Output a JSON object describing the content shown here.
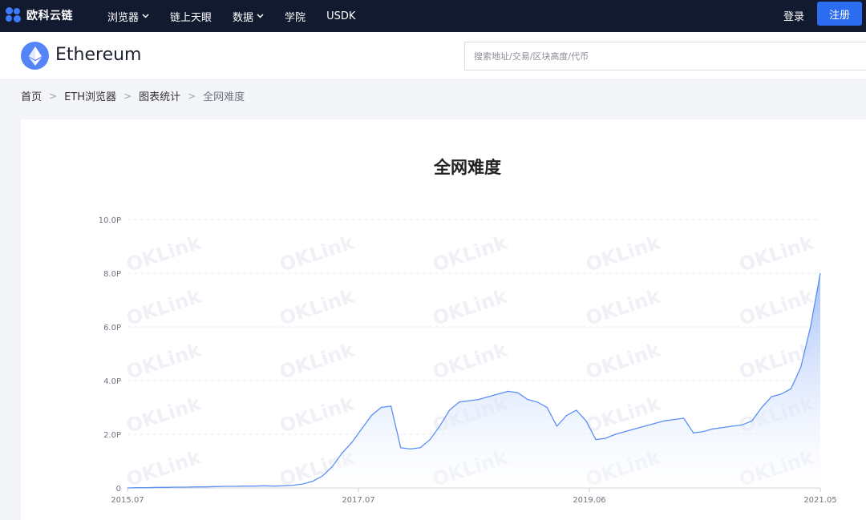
{
  "brand": {
    "name": "欧科云链",
    "logo_icon": "okcloud-logo-icon",
    "accent": "#3f7bff"
  },
  "nav": {
    "items": [
      {
        "label": "浏览器",
        "has_dropdown": true
      },
      {
        "label": "链上天眼",
        "has_dropdown": false
      },
      {
        "label": "数据",
        "has_dropdown": true
      },
      {
        "label": "学院",
        "has_dropdown": false
      },
      {
        "label": "USDK",
        "has_dropdown": false
      }
    ],
    "login_label": "登录",
    "register_label": "注册",
    "register_color": "#2b6cf1"
  },
  "header": {
    "chain_name": "Ethereum",
    "chain_icon": "ethereum-icon",
    "search_placeholder": "搜索地址/交易/区块高度/代币"
  },
  "breadcrumb": [
    "首页",
    "ETH浏览器",
    "图表统计",
    "全网难度"
  ],
  "breadcrumb_separator": ">",
  "watermark": "OKLink",
  "chart_data": {
    "type": "area",
    "title": "全网难度",
    "xlabel": "",
    "ylabel": "",
    "y_ticks": [
      "0",
      "2.0P",
      "4.0P",
      "6.0P",
      "8.0P",
      "10.0P"
    ],
    "ylim": [
      0,
      10
    ],
    "x_ticks": [
      "2015.07",
      "2017.07",
      "2019.06",
      "2021.05"
    ],
    "grid": true,
    "line_color": "#5b8ff5",
    "x": [
      0,
      1,
      2,
      3,
      4,
      5,
      6,
      7,
      8,
      9,
      10,
      11,
      12,
      13,
      14,
      15,
      16,
      17,
      18,
      19,
      20,
      21,
      22,
      23,
      24,
      25,
      26,
      27,
      28,
      29,
      30,
      31,
      32,
      33,
      34,
      35,
      36,
      37,
      38,
      39,
      40,
      41,
      42,
      43,
      44,
      45,
      46,
      47,
      48,
      49,
      50,
      51,
      52,
      53,
      54,
      55,
      56,
      57,
      58,
      59,
      60,
      61,
      62,
      63,
      64,
      65,
      66,
      67,
      68,
      69,
      70,
      71
    ],
    "values": [
      0.0,
      0.01,
      0.01,
      0.02,
      0.02,
      0.03,
      0.03,
      0.04,
      0.04,
      0.05,
      0.06,
      0.06,
      0.07,
      0.07,
      0.08,
      0.07,
      0.08,
      0.1,
      0.15,
      0.25,
      0.45,
      0.8,
      1.3,
      1.7,
      2.2,
      2.7,
      3.0,
      3.05,
      1.5,
      1.45,
      1.5,
      1.8,
      2.3,
      2.9,
      3.2,
      3.25,
      3.3,
      3.4,
      3.5,
      3.6,
      3.55,
      3.3,
      3.2,
      3.0,
      2.3,
      2.7,
      2.9,
      2.5,
      1.8,
      1.85,
      2.0,
      2.1,
      2.2,
      2.3,
      2.4,
      2.5,
      2.55,
      2.6,
      2.05,
      2.1,
      2.2,
      2.25,
      2.3,
      2.35,
      2.5,
      3.0,
      3.4,
      3.5,
      3.7,
      4.5,
      6.0,
      8.0
    ]
  }
}
